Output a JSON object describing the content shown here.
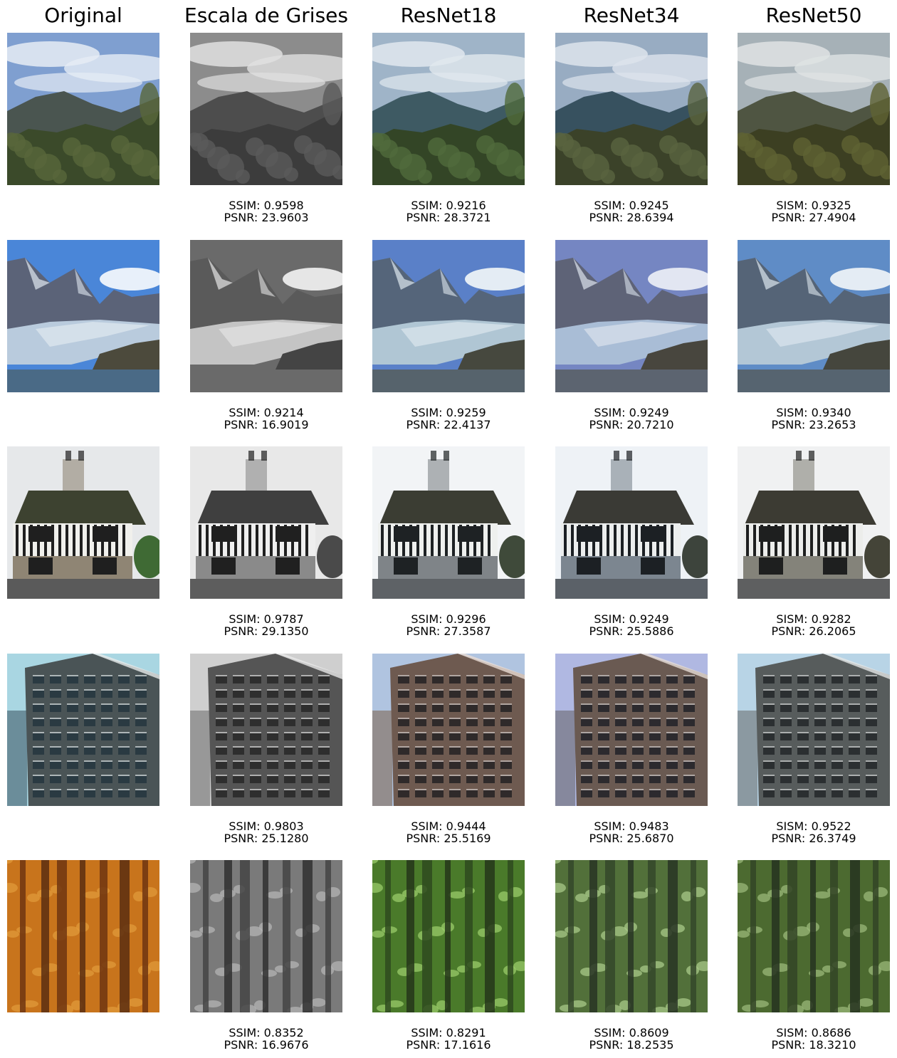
{
  "columns": [
    "Original",
    "Escala de Grises",
    "ResNet18",
    "ResNet34",
    "ResNet50"
  ],
  "rows": [
    {
      "scene": "mountain-valley",
      "metrics": [
        null,
        {
          "ssim": "SSIM: 0.9598",
          "psnr": "PSNR: 23.9603"
        },
        {
          "ssim": "SSIM: 0.9216",
          "psnr": "PSNR: 28.3721"
        },
        {
          "ssim": "SSIM: 0.9245",
          "psnr": "PSNR: 28.6394"
        },
        {
          "ssim": "SISM: 0.9325",
          "psnr": "PSNR: 27.4904"
        }
      ]
    },
    {
      "scene": "glacier",
      "metrics": [
        null,
        {
          "ssim": "SSIM: 0.9214",
          "psnr": "PSNR: 16.9019"
        },
        {
          "ssim": "SSIM: 0.9259",
          "psnr": "PSNR: 22.4137"
        },
        {
          "ssim": "SSIM: 0.9249",
          "psnr": "PSNR: 20.7210"
        },
        {
          "ssim": "SISM: 0.9340",
          "psnr": "PSNR: 23.2653"
        }
      ]
    },
    {
      "scene": "tudor-house",
      "metrics": [
        null,
        {
          "ssim": "SSIM: 0.9787",
          "psnr": "PSNR: 29.1350"
        },
        {
          "ssim": "SSIM: 0.9296",
          "psnr": "PSNR: 27.3587"
        },
        {
          "ssim": "SSIM: 0.9249",
          "psnr": "PSNR: 25.5886"
        },
        {
          "ssim": "SISM: 0.9282",
          "psnr": "PSNR: 26.2065"
        }
      ]
    },
    {
      "scene": "office-building",
      "metrics": [
        null,
        {
          "ssim": "SSIM: 0.9803",
          "psnr": "PSNR: 25.1280"
        },
        {
          "ssim": "SSIM: 0.9444",
          "psnr": "PSNR: 25.5169"
        },
        {
          "ssim": "SSIM: 0.9483",
          "psnr": "PSNR: 25.6870"
        },
        {
          "ssim": "SISM: 0.9522",
          "psnr": "PSNR: 26.3749"
        }
      ]
    },
    {
      "scene": "forest",
      "metrics": [
        null,
        {
          "ssim": "SSIM: 0.8352",
          "psnr": "PSNR: 16.9676"
        },
        {
          "ssim": "SSIM: 0.8291",
          "psnr": "PSNR: 17.1616"
        },
        {
          "ssim": "SSIM: 0.8609",
          "psnr": "PSNR: 18.2535"
        },
        {
          "ssim": "SISM: 0.8686",
          "psnr": "PSNR: 18.3210"
        }
      ]
    }
  ],
  "palettes": {
    "mountain-valley": [
      {
        "sky": "#7f9fd0",
        "cloud": "#e6ecf5",
        "hill": "#4a5550",
        "forest": "#3b4a2a",
        "tree": "#59663b"
      },
      {
        "sky": "#8c8c8c",
        "cloud": "#e0e0e0",
        "hill": "#4d4d4d",
        "forest": "#3c3c3c",
        "tree": "#5a5a5a"
      },
      {
        "sky": "#9fb4c8",
        "cloud": "#e1e8ee",
        "hill": "#3e5a63",
        "forest": "#334526",
        "tree": "#506a3c"
      },
      {
        "sky": "#98acc2",
        "cloud": "#dde4ec",
        "hill": "#37515f",
        "forest": "#3b4229",
        "tree": "#5a6440"
      },
      {
        "sky": "#a6b1b7",
        "cloud": "#dfe3e4",
        "hill": "#4f5542",
        "forest": "#3c3f22",
        "tree": "#5f6333"
      }
    ],
    "glacier": [
      {
        "sky": "#4a86d8",
        "cloud": "#e8f0fa",
        "mountain": "#5b6378",
        "snow": "#dfe8f0",
        "ice": "#b9cbdd",
        "rock": "#4c4a3c",
        "water": "#4a6a86"
      },
      {
        "sky": "#6a6a6a",
        "cloud": "#e6e6e6",
        "mountain": "#5a5a5a",
        "snow": "#e4e4e4",
        "ice": "#c4c4c4",
        "rock": "#444444",
        "water": "#6a6a6a"
      },
      {
        "sky": "#5a80c8",
        "cloud": "#e4ecf4",
        "mountain": "#55657a",
        "snow": "#dde7ee",
        "ice": "#b0c6d4",
        "rock": "#46483e",
        "water": "#56636c"
      },
      {
        "sky": "#7586c2",
        "cloud": "#e2e6f2",
        "mountain": "#5e6377",
        "snow": "#dbe2ec",
        "ice": "#a9bdd6",
        "rock": "#48463e",
        "water": "#5c6470"
      },
      {
        "sky": "#5f8cc6",
        "cloud": "#e4ecf4",
        "mountain": "#556477",
        "snow": "#dce6ee",
        "ice": "#b3c7d6",
        "rock": "#45463d",
        "water": "#566470"
      }
    ],
    "tudor-house": [
      {
        "sky": "#e6e8ea",
        "roof": "#3d4230",
        "wall": "#f0f0ec",
        "timber": "#1f1f1f",
        "base": "#8f8574",
        "road": "#5a5a5a",
        "bush": "#3f6a34"
      },
      {
        "sky": "#e8e8e8",
        "roof": "#3f3f3f",
        "wall": "#efefef",
        "timber": "#202020",
        "base": "#8a8a8a",
        "road": "#5d5d5d",
        "bush": "#4a4a4a"
      },
      {
        "sky": "#f2f4f6",
        "roof": "#3b3d33",
        "wall": "#eef0ee",
        "timber": "#1e2224",
        "base": "#7f8488",
        "road": "#5e6266",
        "bush": "#3f4a3a"
      },
      {
        "sky": "#eef2f6",
        "roof": "#3a3a35",
        "wall": "#eceeee",
        "timber": "#1c2024",
        "base": "#7c8690",
        "road": "#5b6168",
        "bush": "#3d443c"
      },
      {
        "sky": "#f0f1f2",
        "roof": "#3c3b33",
        "wall": "#ecedeb",
        "timber": "#1e1f1f",
        "base": "#84837a",
        "road": "#5e5f60",
        "bush": "#444438"
      }
    ],
    "office-building": [
      {
        "sky": "#a9d6e2",
        "facade": "#4a5456",
        "window": "#2a3a42",
        "edge": "#e6eaea",
        "left": "#5b7a88"
      },
      {
        "sky": "#cfcfcf",
        "facade": "#555555",
        "window": "#2e2e2e",
        "edge": "#e8e8e8",
        "left": "#8a8a8a"
      },
      {
        "sky": "#b0c4e0",
        "facade": "#6e5a50",
        "window": "#2f2a2a",
        "edge": "#e8dcd4",
        "left": "#8c8078"
      },
      {
        "sky": "#b0b8e2",
        "facade": "#6a5a52",
        "window": "#2c2a2e",
        "edge": "#e6dcd6",
        "left": "#7c7c8c"
      },
      {
        "sky": "#b8d4e6",
        "facade": "#575c5c",
        "window": "#2b2f31",
        "edge": "#e4e6e6",
        "left": "#7f8a90"
      }
    ],
    "forest": [
      {
        "bg": "#c8741c",
        "leaf": "#e09a3a",
        "trunk": "#5a2e10",
        "dark": "#6e3510"
      },
      {
        "bg": "#7a7a7a",
        "leaf": "#b4b4b4",
        "trunk": "#303030",
        "dark": "#444444"
      },
      {
        "bg": "#4a7a2a",
        "leaf": "#9acb6a",
        "trunk": "#24361a",
        "dark": "#2e4a1e"
      },
      {
        "bg": "#52703a",
        "leaf": "#a8c888",
        "trunk": "#283424",
        "dark": "#34462a"
      },
      {
        "bg": "#4c6a30",
        "leaf": "#9ab878",
        "trunk": "#263220",
        "dark": "#324426"
      }
    ]
  }
}
